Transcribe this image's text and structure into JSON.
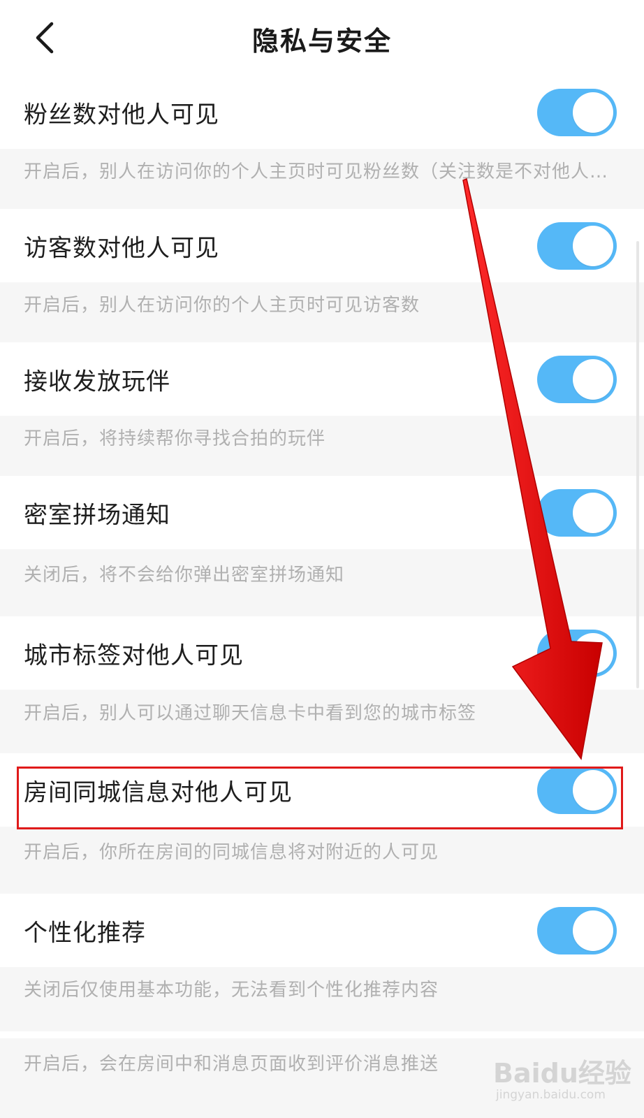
{
  "header": {
    "title": "隐私与安全",
    "back_icon": "chevron-left-icon"
  },
  "colors": {
    "toggle_on": "#55b8f7",
    "highlight": "#e01a1a",
    "arrow": "#ee1111"
  },
  "settings": [
    {
      "label": "粉丝数对他人可见",
      "desc": "开启后，别人在访问你的个人主页时可见粉丝数（关注数是不对他人…",
      "on": true
    },
    {
      "label": "访客数对他人可见",
      "desc": "开启后，别人在访问你的个人主页时可见访客数",
      "on": true
    },
    {
      "label": "接收发放玩伴",
      "desc": "开启后，将持续帮你寻找合拍的玩伴",
      "on": true
    },
    {
      "label": "密室拼场通知",
      "desc": "关闭后，将不会给你弹出密室拼场通知",
      "on": true
    },
    {
      "label": "城市标签对他人可见",
      "desc": "开启后，别人可以通过聊天信息卡中看到您的城市标签",
      "on": true
    },
    {
      "label": "房间同城信息对他人可见",
      "desc": "开启后，你所在房间的同城信息将对附近的人可见",
      "on": true
    },
    {
      "label": "个性化推荐",
      "desc": "关闭后仅使用基本功能，无法看到个性化推荐内容",
      "on": true
    }
  ],
  "last_desc": "开启后，会在房间中和消息页面收到评价消息推送",
  "watermark": {
    "logo": "Baidu经验",
    "url": "jingyan.baidu.com"
  }
}
